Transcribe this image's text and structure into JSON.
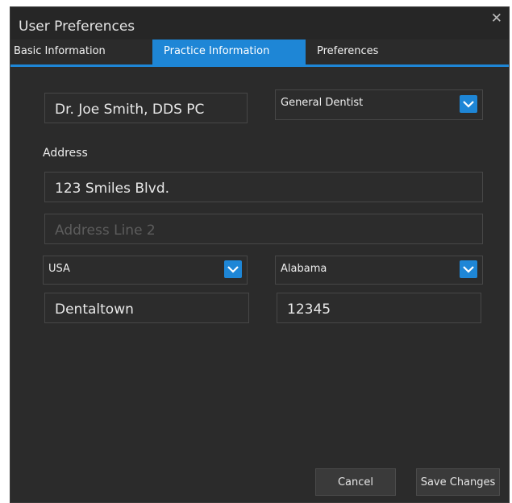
{
  "window": {
    "title": "User Preferences",
    "close_glyph": "✕"
  },
  "tabs": [
    {
      "label": "Basic Information",
      "active": false
    },
    {
      "label": "Practice Information",
      "active": true
    },
    {
      "label": "Preferences",
      "active": false
    }
  ],
  "practice": {
    "name_value": "Dr. Joe Smith, DDS PC",
    "specialty_value": "General Dentist"
  },
  "address": {
    "heading": "Address",
    "line1_value": "123 Smiles Blvd.",
    "line2_placeholder": "Address Line 2",
    "country_value": "USA",
    "state_value": "Alabama",
    "city_value": "Dentaltown",
    "zip_value": "12345"
  },
  "buttons": {
    "cancel_label": "Cancel",
    "save_label": "Save Changes"
  },
  "colors": {
    "accent": "#1e86d6",
    "background": "#2b2b2b"
  },
  "icons": {
    "dropdown": "chevron-down-icon",
    "close": "close-icon"
  }
}
